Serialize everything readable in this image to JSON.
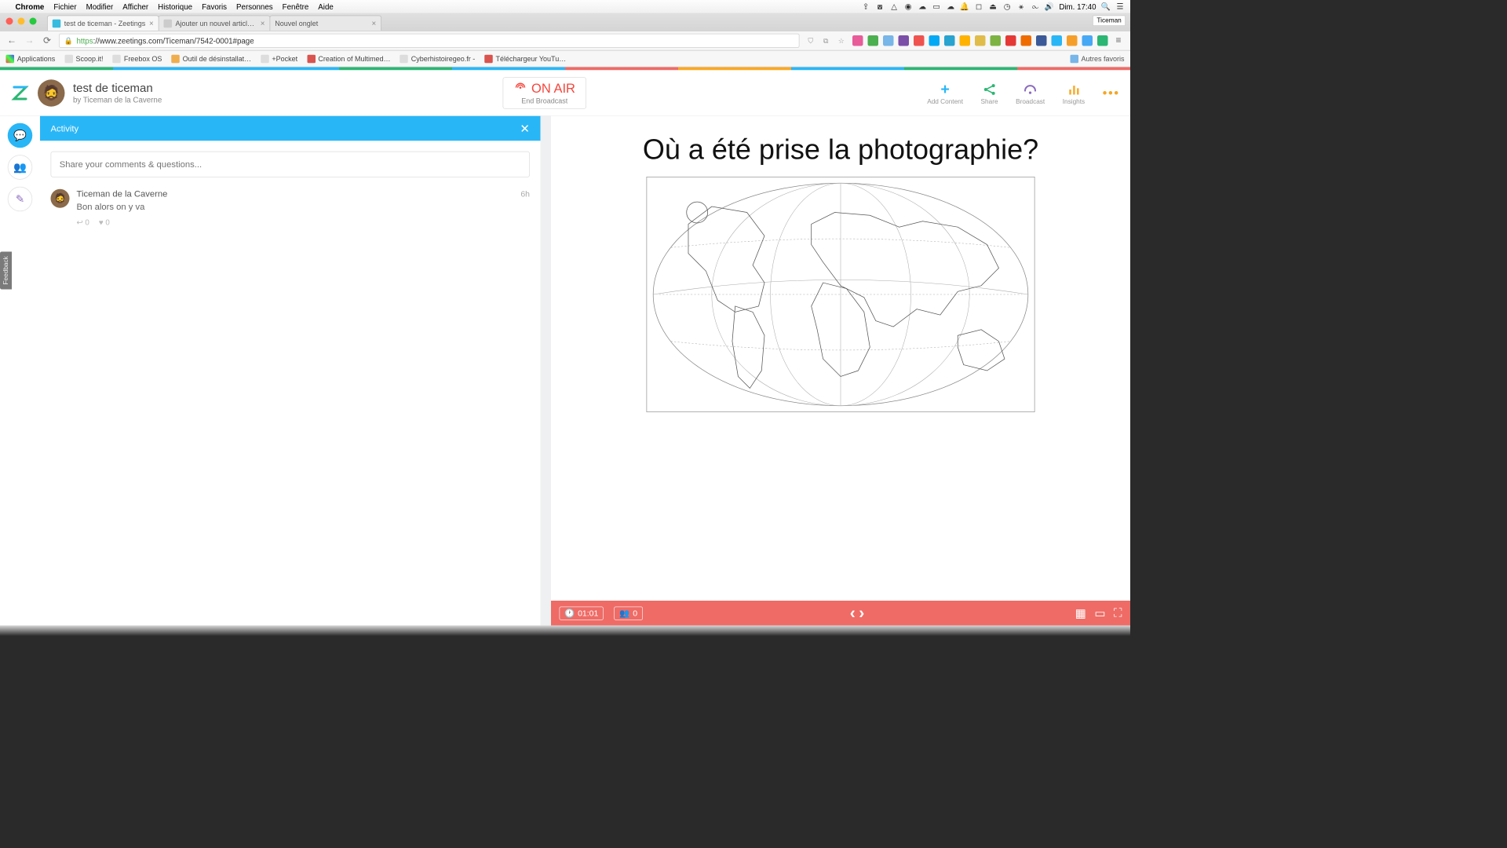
{
  "menubar": {
    "app": "Chrome",
    "items": [
      "Fichier",
      "Modifier",
      "Afficher",
      "Historique",
      "Favoris",
      "Personnes",
      "Fenêtre",
      "Aide"
    ],
    "time": "Dim. 17:40"
  },
  "chrome": {
    "user": "Ticeman",
    "tabs": [
      {
        "title": "test de ticeman - Zeetings",
        "active": true
      },
      {
        "title": "Ajouter un nouvel article ‹ Le…",
        "active": false
      },
      {
        "title": "Nouvel onglet",
        "active": false
      }
    ],
    "url_proto": "https",
    "url_rest": "://www.zeetings.com/Ticeman/7542-0001#page",
    "bookmarks": [
      "Applications",
      "Scoop.it!",
      "Freebox OS",
      "Outil de désinstallat…",
      "+Pocket",
      "Creation of Multimed…",
      "Cyberhistoiregeo.fr -",
      "Téléchargeur YouTu…"
    ],
    "other_fav": "Autres favoris"
  },
  "rainbow": [
    "#2bb673",
    "#29b6f6",
    "#29b6f6",
    "#2bb673",
    "#29b6f6",
    "#ef6b66",
    "#f9a825",
    "#29b6f6",
    "#2bb673",
    "#ef6b66"
  ],
  "zeetings": {
    "title": "test de ticeman",
    "by": "by Ticeman de la Caverne",
    "onair": "ON AIR",
    "end": "End Broadcast",
    "actions": [
      {
        "icon": "+",
        "label": "Add Content",
        "color": "#29b6f6"
      },
      {
        "icon": "share",
        "label": "Share",
        "color": "#2bb673"
      },
      {
        "icon": "wifi",
        "label": "Broadcast",
        "color": "#8a6bbf"
      },
      {
        "icon": "bars",
        "label": "Insights",
        "color": "#f9a825"
      }
    ]
  },
  "activity": {
    "header": "Activity",
    "placeholder": "Share your comments & questions...",
    "comment": {
      "name": "Ticeman de la Caverne",
      "time": "6h",
      "text": "Bon alors on y va",
      "replies": "0",
      "likes": "0"
    }
  },
  "slide": {
    "question": "Où a été prise la photographie?",
    "timer": "01:01",
    "viewers": "0"
  },
  "feedback": "Feedback"
}
